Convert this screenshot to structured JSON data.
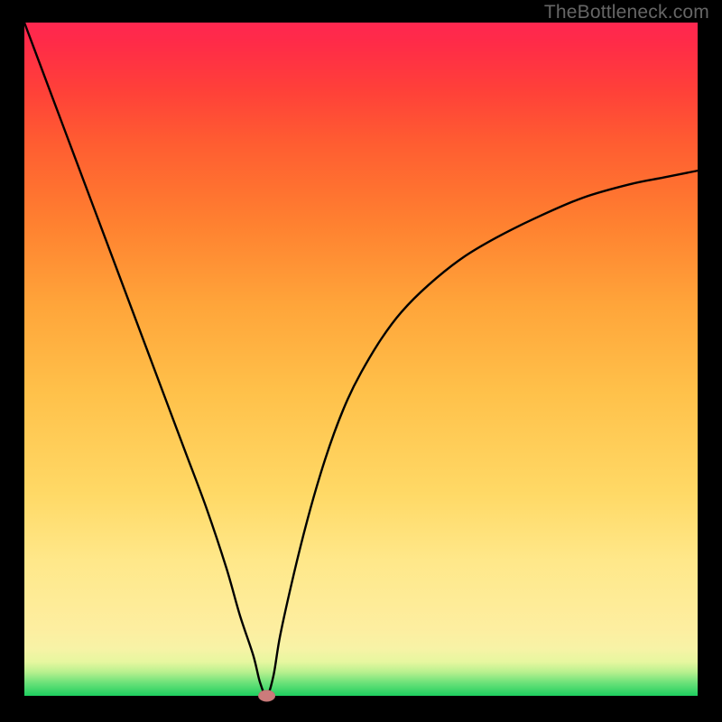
{
  "watermark": "TheBottleneck.com",
  "colors": {
    "frame_bg": "#000000",
    "curve": "#000000",
    "marker": "#cc7b7b"
  },
  "chart_data": {
    "type": "line",
    "title": "",
    "xlabel": "",
    "ylabel": "",
    "xlim": [
      0,
      100
    ],
    "ylim": [
      0,
      100
    ],
    "x": [
      0,
      3,
      6,
      9,
      12,
      15,
      18,
      21,
      24,
      27,
      30,
      32,
      34,
      35,
      36,
      37,
      38,
      40,
      42,
      44,
      46,
      48,
      50,
      53,
      56,
      60,
      65,
      70,
      76,
      83,
      90,
      95,
      100
    ],
    "values": [
      100,
      92,
      84,
      76,
      68,
      60,
      52,
      44,
      36,
      28,
      19,
      12,
      6,
      2,
      0,
      3,
      9,
      18,
      26,
      33,
      39,
      44,
      48,
      53,
      57,
      61,
      65,
      68,
      71,
      74,
      76,
      77,
      78
    ],
    "marker": {
      "x": 36,
      "y": 0
    }
  }
}
